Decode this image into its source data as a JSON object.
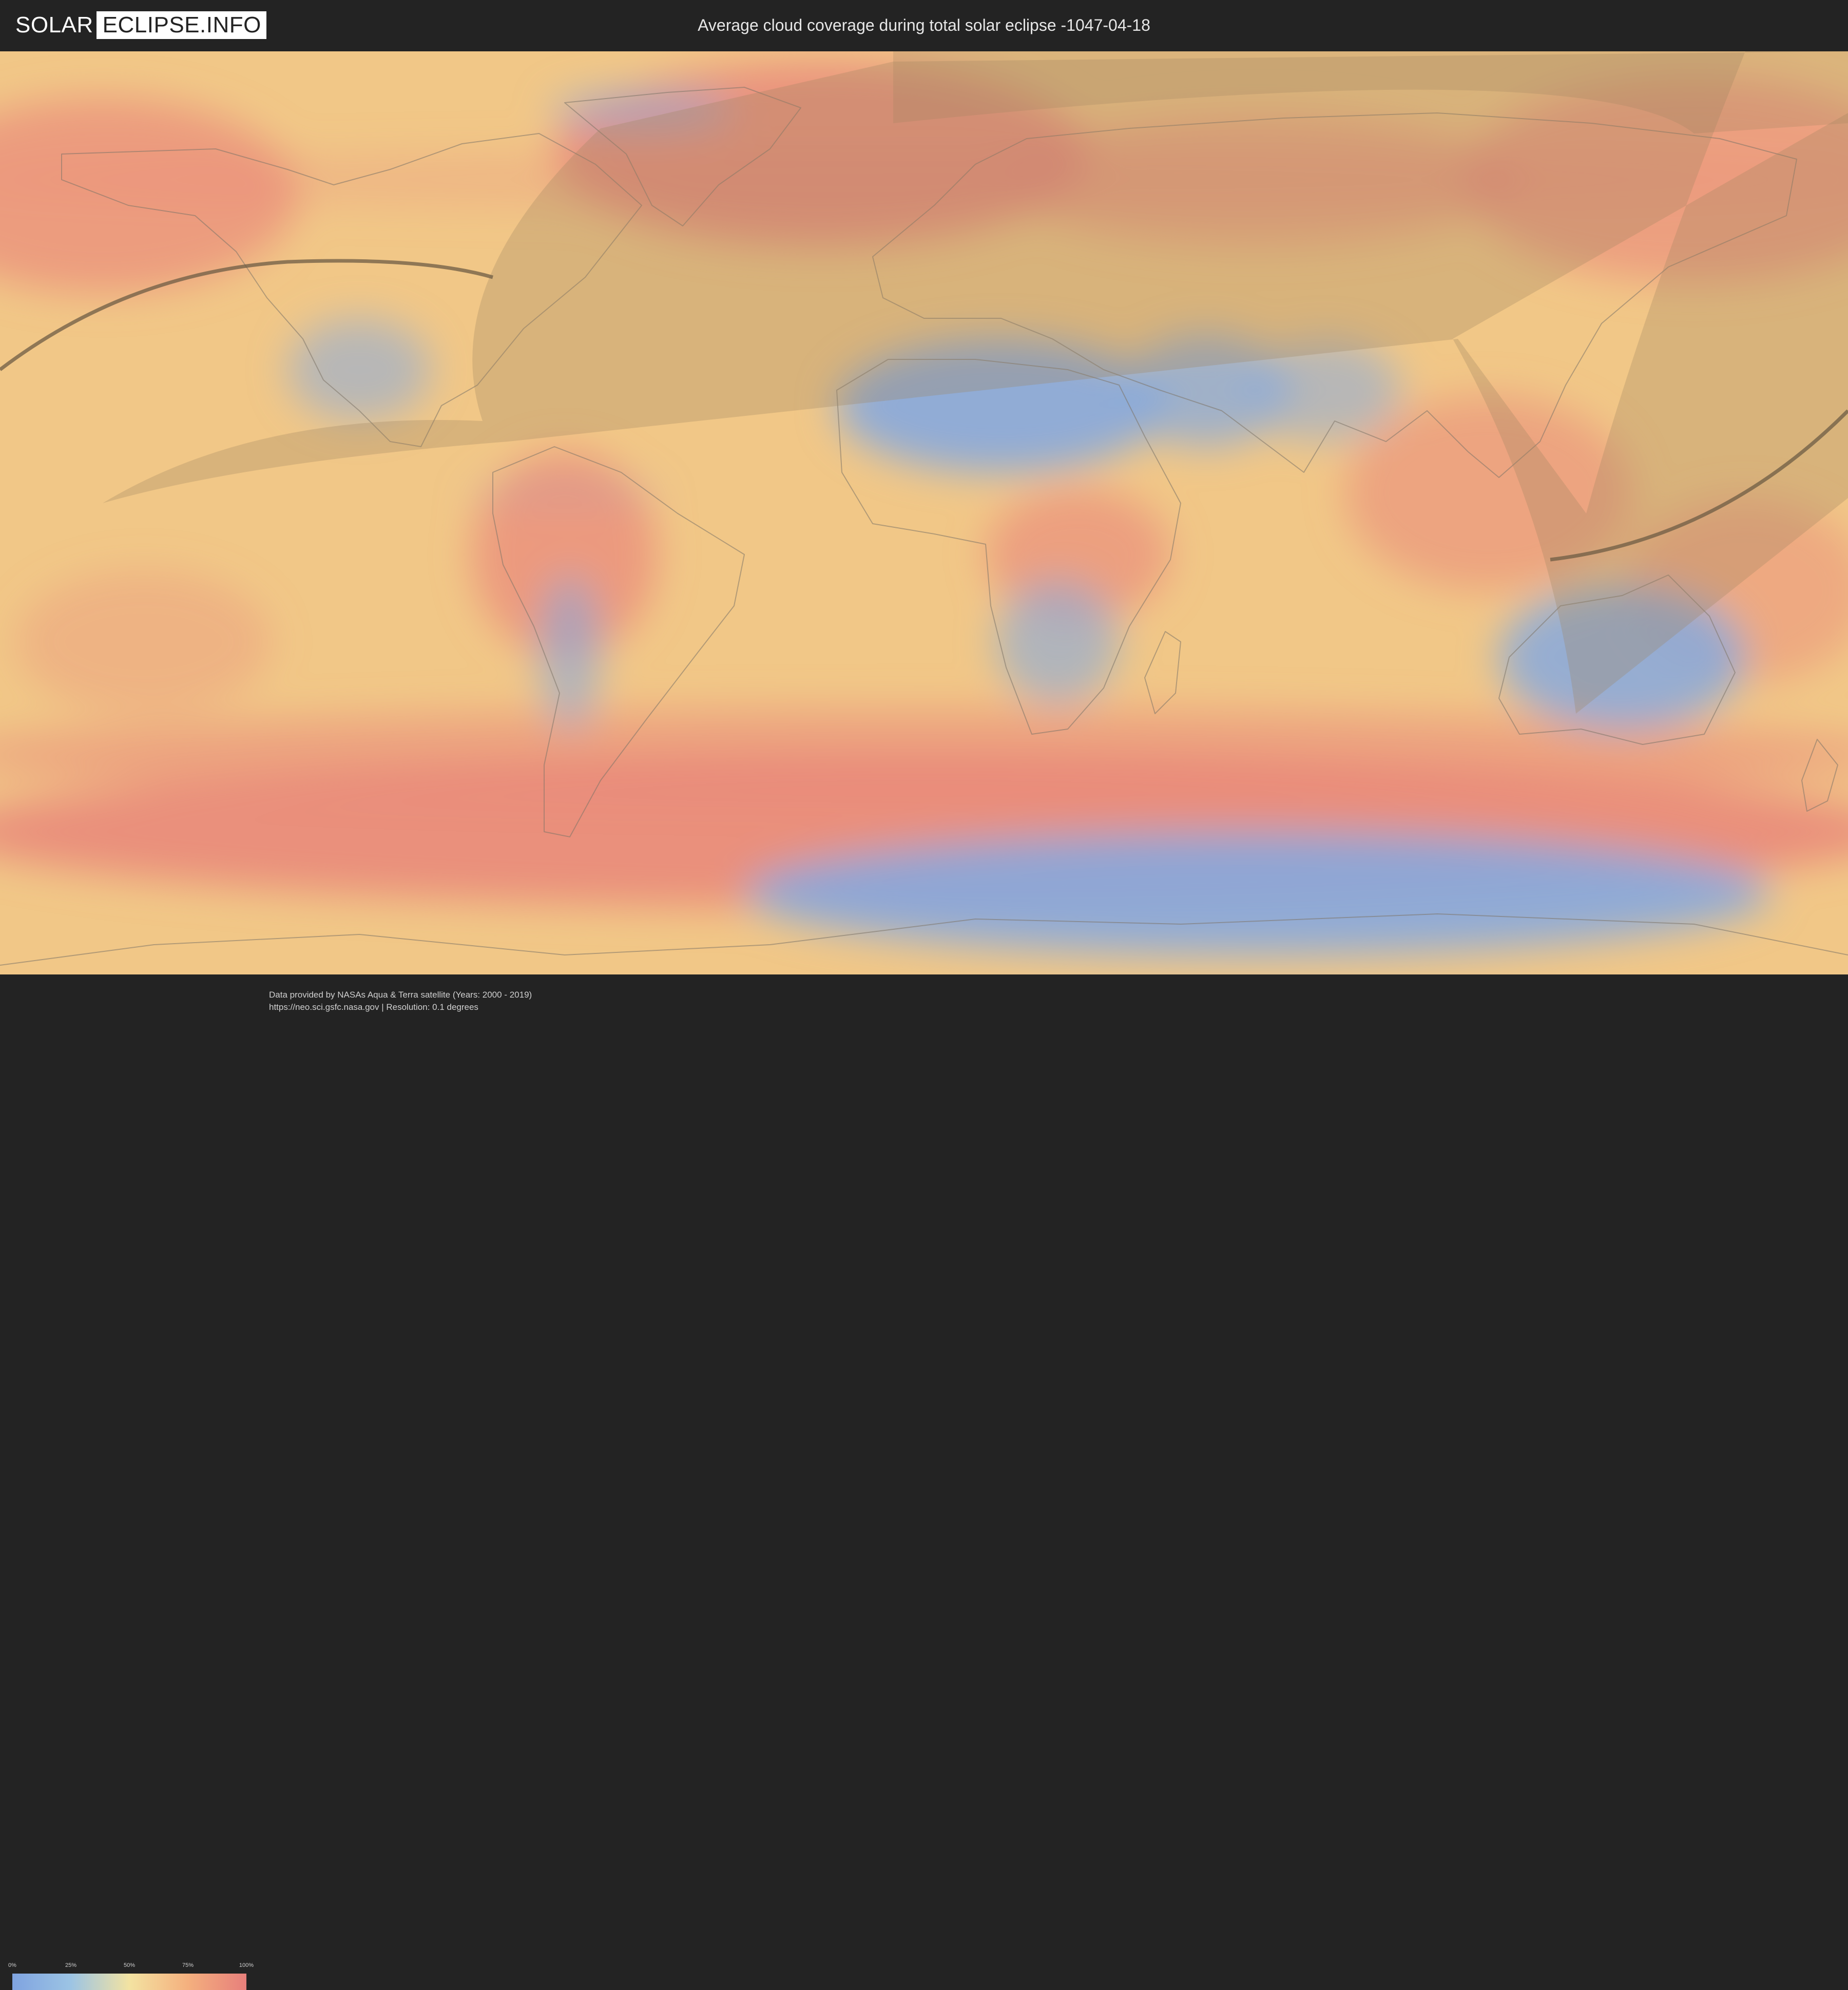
{
  "header": {
    "logo_part1": "SOLAR",
    "logo_part2": "ECLIPSE.INFO",
    "title": "Average cloud coverage during total solar eclipse -1047-04-18"
  },
  "legend": {
    "ticks": [
      "0%",
      "25%",
      "50%",
      "75%",
      "100%"
    ],
    "colors": [
      "#7fa3e0",
      "#9cc4e4",
      "#f3e3a2",
      "#f4b07e",
      "#e77f7b"
    ]
  },
  "footer": {
    "source_line": "Data provided by NASAs Aqua & Terra satellite (Years: 2000 - 2019)",
    "url_line": "https://neo.sci.gsfc.nasa.gov | Resolution: 0.1 degrees"
  },
  "map": {
    "colors": {
      "ocean": "#f1c787",
      "high_cloud": "#e9867a",
      "low_cloud": "#86a9de",
      "visibility_zone": "#a08560",
      "eclipse_path": "#6e5c44",
      "coastline": "#7d7468"
    }
  }
}
